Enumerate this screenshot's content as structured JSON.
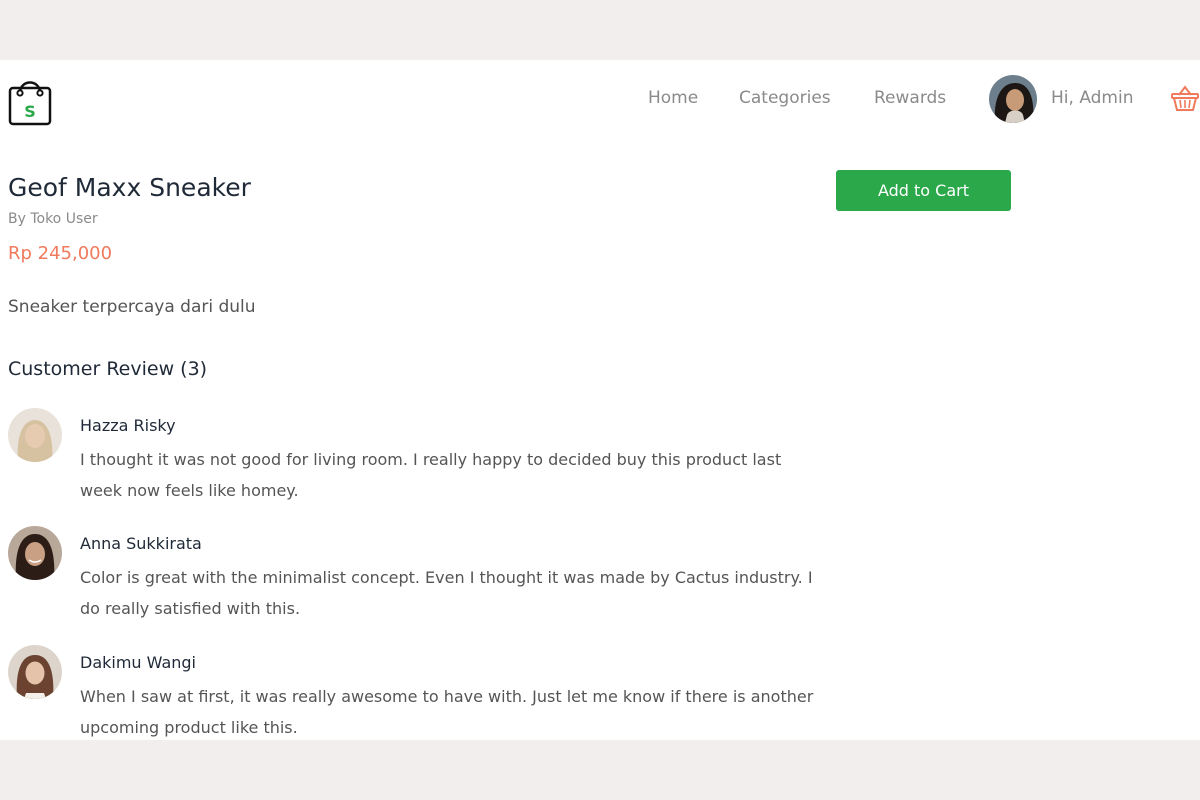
{
  "header": {
    "logo_icon": "shopping-bag-s-icon",
    "logo_letter": "S",
    "nav": [
      {
        "label": "Home"
      },
      {
        "label": "Categories"
      },
      {
        "label": "Rewards"
      }
    ],
    "greeting": "Hi, Admin",
    "cart_icon": "basket-icon"
  },
  "product": {
    "title": "Geof Maxx Sneaker",
    "seller": "By Toko User",
    "price": "Rp 245,000",
    "description": "Sneaker terpercaya dari dulu",
    "add_to_cart_label": "Add to Cart"
  },
  "reviews": {
    "heading": "Customer Review (3)",
    "items": [
      {
        "name": "Hazza Risky",
        "text": "I thought it was not good for living room. I really happy to decided buy this product last week now feels like homey."
      },
      {
        "name": "Anna Sukkirata",
        "text": "Color is great with the minimalist concept. Even I thought it was made by Cactus industry. I do really satisfied with this."
      },
      {
        "name": "Dakimu Wangi",
        "text": "When I saw at first, it was really awesome to have with. Just let me know if there is another upcoming product like this."
      }
    ]
  },
  "colors": {
    "accent_green": "#2ba84a",
    "price_color": "#f07a5c",
    "cart_icon_color": "#f07a5c"
  }
}
